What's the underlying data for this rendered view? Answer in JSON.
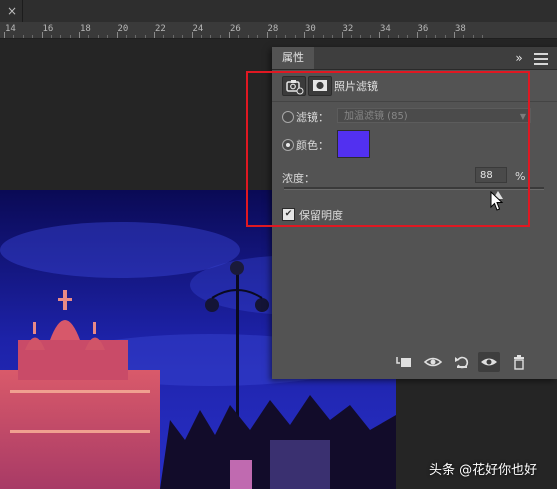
{
  "tab": {
    "close_glyph": "×"
  },
  "ruler": {
    "labels": [
      "14",
      "16",
      "18",
      "20",
      "22",
      "24",
      "26",
      "28",
      "30",
      "32",
      "34",
      "36",
      "38"
    ]
  },
  "panel": {
    "tab_label": "属性",
    "collapse_glyph": "»",
    "title": "照片滤镜",
    "filter_label": "滤镜：",
    "filter_value": "加温滤镜 (85)",
    "color_label": "颜色：",
    "color_value": "#5230f0",
    "density_label": "浓度：",
    "density_value": "88",
    "density_unit": "%",
    "density_fraction": 0.88,
    "preserve_luminosity_label": "保留明度",
    "preserve_luminosity_checked": true,
    "footer_icons": [
      "clip-to-layer-icon",
      "view-previous-icon",
      "reset-icon",
      "visibility-icon",
      "delete-icon"
    ]
  },
  "highlight_color": "#e01822",
  "watermark": "头条 @花好你也好"
}
